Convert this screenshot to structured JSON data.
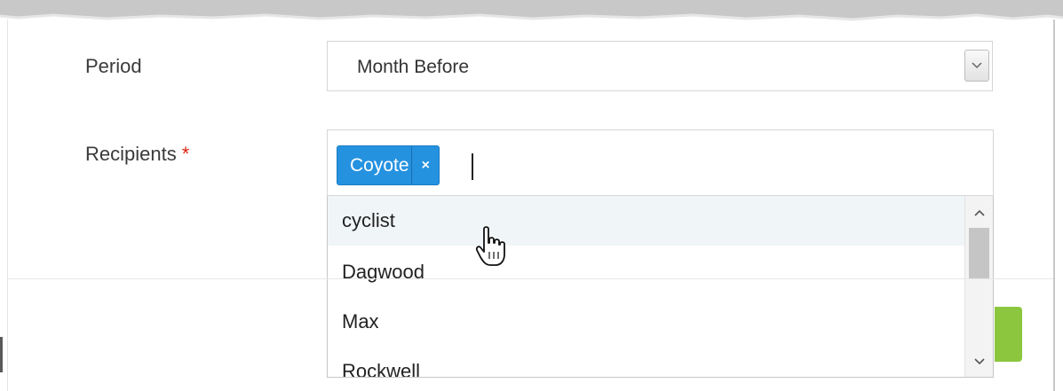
{
  "form": {
    "period": {
      "label": "Period",
      "value": "Month Before"
    },
    "recipients": {
      "label": "Recipients",
      "required_marker": "*",
      "selected_tags": [
        {
          "label": "Coyote",
          "remove_label": "×"
        }
      ],
      "options": [
        {
          "label": "cyclist"
        },
        {
          "label": "Dagwood"
        },
        {
          "label": "Max"
        },
        {
          "label": "Rockwell"
        }
      ],
      "hovered_option": "cyclist"
    }
  },
  "colors": {
    "tag_blue": "#2592e0",
    "required_red": "#d9230f",
    "submit_green": "#8cc63f"
  },
  "icons": {
    "select_arrow": "chevron-down-icon",
    "scroll_up": "chevron-up-icon",
    "scroll_down": "chevron-down-icon",
    "cursor": "hand-pointer-icon"
  }
}
